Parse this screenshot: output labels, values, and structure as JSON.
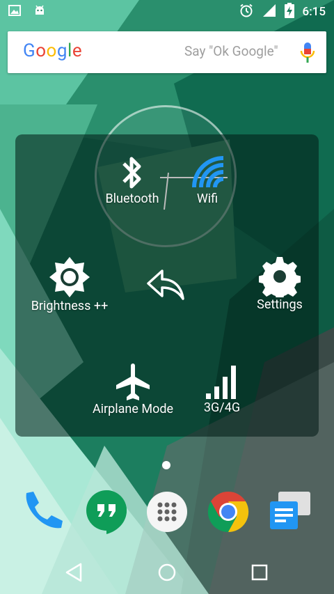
{
  "status_bar": {
    "time": "6:15",
    "icons": [
      "image-notification-icon",
      "android-notification-icon",
      "alarm-icon",
      "signal-icon",
      "battery-charging-icon"
    ]
  },
  "search": {
    "logo": [
      "G",
      "o",
      "o",
      "g",
      "l",
      "e"
    ],
    "hint": "Say \"Ok Google\""
  },
  "panel": {
    "bluetooth_label": "Bluetooth",
    "wifi_label": "Wifi",
    "brightness_label": "Brightness ++",
    "settings_label": "Settings",
    "airplane_label": "Airplane Mode",
    "network_label": "3G/4G"
  },
  "dock": {
    "apps": [
      "phone-icon",
      "hangouts-icon",
      "app-drawer-icon",
      "chrome-icon",
      "messages-icon"
    ]
  },
  "colors": {
    "wifi_blue": "#2196f3",
    "accent_green": "#0f9d58"
  }
}
